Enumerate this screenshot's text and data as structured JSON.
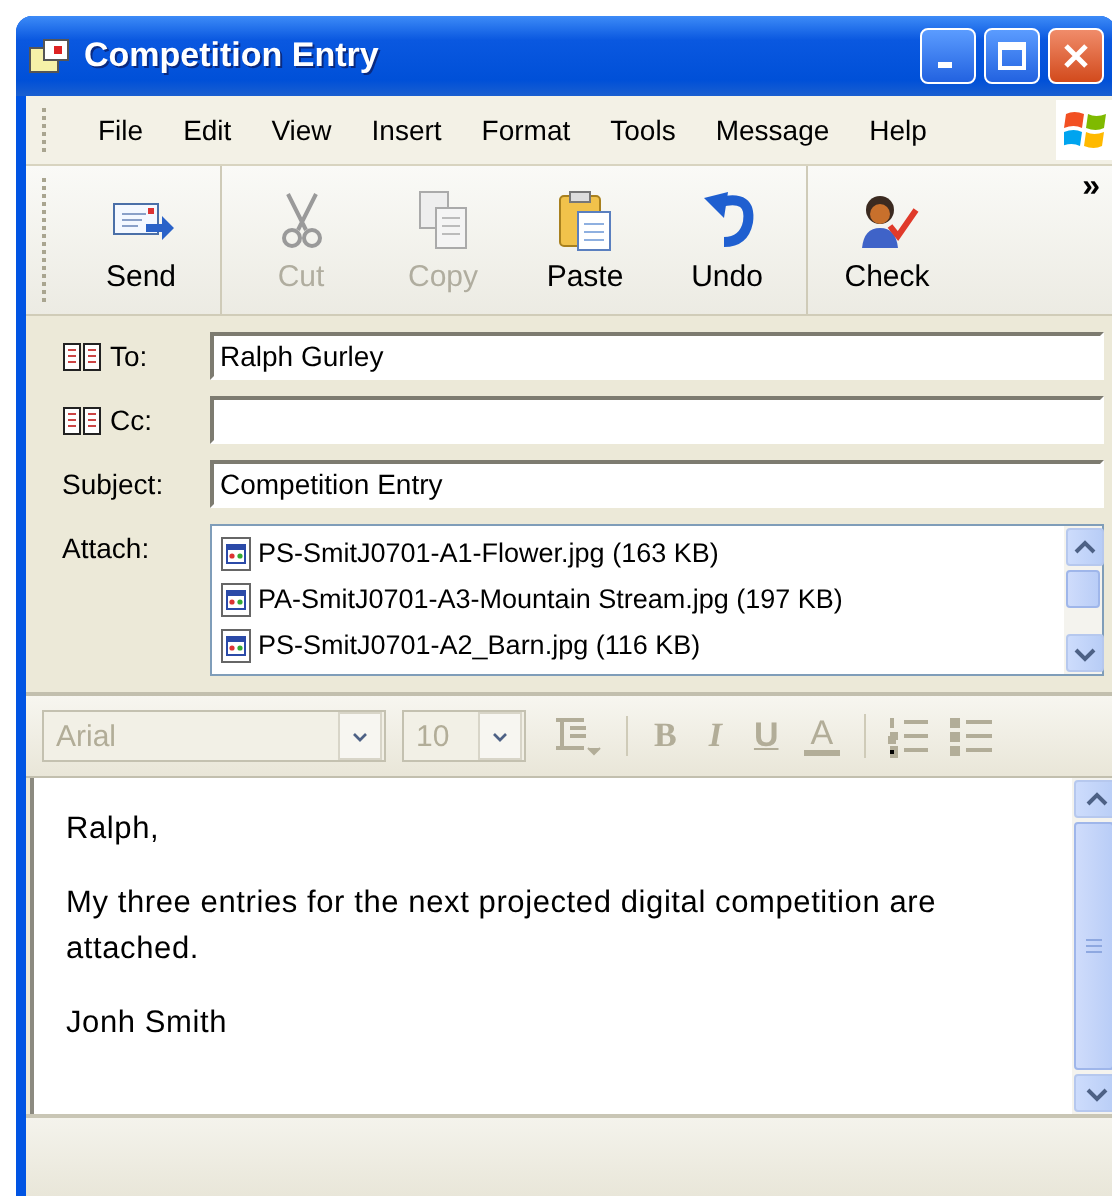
{
  "window": {
    "title": "Competition Entry"
  },
  "menu": [
    {
      "label": "File"
    },
    {
      "label": "Edit"
    },
    {
      "label": "View"
    },
    {
      "label": "Insert"
    },
    {
      "label": "Format"
    },
    {
      "label": "Tools"
    },
    {
      "label": "Message"
    },
    {
      "label": "Help"
    }
  ],
  "toolbar": {
    "groups": [
      {
        "buttons": [
          {
            "label": "Send",
            "kind": "send",
            "disabled": false
          }
        ]
      },
      {
        "buttons": [
          {
            "label": "Cut",
            "kind": "cut",
            "disabled": true
          },
          {
            "label": "Copy",
            "kind": "copy",
            "disabled": true
          },
          {
            "label": "Paste",
            "kind": "paste",
            "disabled": false
          },
          {
            "label": "Undo",
            "kind": "undo",
            "disabled": false
          }
        ]
      },
      {
        "buttons": [
          {
            "label": "Check",
            "kind": "check",
            "disabled": false
          }
        ]
      }
    ],
    "overflow": "»"
  },
  "header": {
    "fields": [
      {
        "label": "To:",
        "kind": "address",
        "value": "Ralph Gurley"
      },
      {
        "label": "Cc:",
        "kind": "address"
      },
      {
        "label": "Subject:",
        "kind": "plain",
        "value": "Competition Entry"
      }
    ],
    "attach": {
      "label": "Attach:",
      "files": [
        {
          "name": "PS-SmitJ0701-A1-Flower.jpg (163 KB)"
        },
        {
          "name": "PA-SmitJ0701-A3-Mountain Stream.jpg (197 KB)"
        },
        {
          "name": "PS-SmitJ0701-A2_Barn.jpg (116 KB)"
        }
      ]
    }
  },
  "format_toolbar": {
    "disabled": true,
    "font": "Arial",
    "size": "10",
    "groups": [
      {
        "tools": [
          {
            "kind": "paragraph"
          }
        ]
      },
      {
        "tools": [
          {
            "kind": "bold",
            "label": "B"
          },
          {
            "kind": "italic",
            "label": "I"
          },
          {
            "kind": "underline",
            "label": "U"
          },
          {
            "kind": "color",
            "label": "A"
          }
        ]
      },
      {
        "tools": [
          {
            "kind": "numbers"
          },
          {
            "kind": "bullets"
          }
        ]
      }
    ]
  },
  "body": {
    "paragraphs": [
      "Ralph,",
      "My three entries for the next projected digital competition are attached.",
      "Jonh Smith"
    ]
  }
}
